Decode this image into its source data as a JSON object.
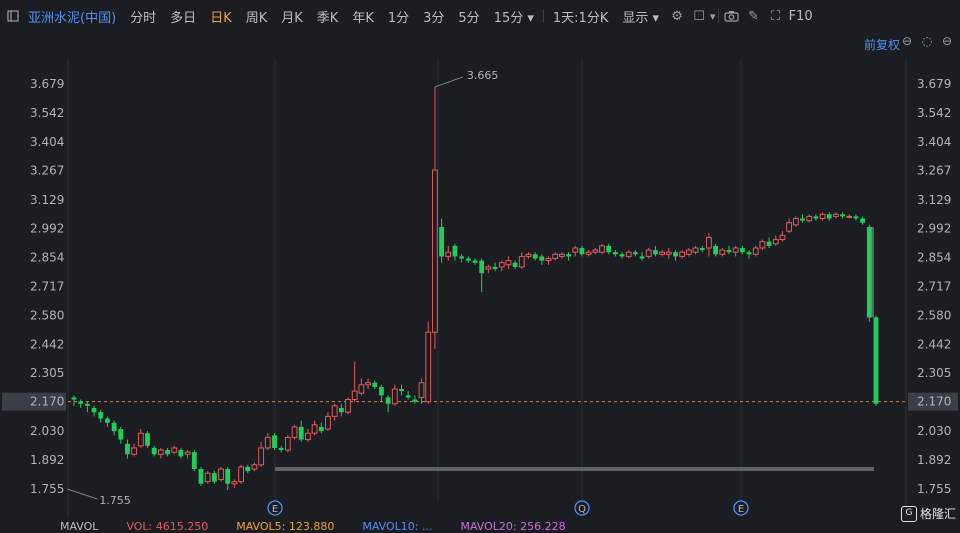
{
  "toolbar": {
    "panel_icon": "panel-toggle-icon",
    "title": "亚洲水泥(中国)",
    "periods": [
      "分时",
      "多日",
      "日K",
      "周K",
      "月K",
      "季K",
      "年K",
      "1分",
      "3分",
      "5分",
      "15分"
    ],
    "active_period": "日K",
    "interval_select": "1天:1分K",
    "display_select": "显示",
    "icons": [
      "gear-icon",
      "square-icon",
      "camera-icon",
      "pencil-icon",
      "fullscreen-icon",
      "f10-icon"
    ],
    "f10_label": "F10"
  },
  "sub": {
    "fuquan": "前复权"
  },
  "price_axis": {
    "ticks": [
      "3.679",
      "3.542",
      "3.404",
      "3.267",
      "3.129",
      "2.992",
      "2.854",
      "2.717",
      "2.580",
      "2.442",
      "2.305",
      "2.170",
      "2.030",
      "1.892",
      "1.755"
    ],
    "current": "2.170"
  },
  "annotations": {
    "high": "3.665",
    "low": "1.755"
  },
  "events": [
    "E",
    "Q",
    "E"
  ],
  "bottom_legend": [
    {
      "text": "MAVOL",
      "color": "#b8bcc4"
    },
    {
      "text": "VOL: 4615.250",
      "color": "#e05b5b"
    },
    {
      "text": "MAVOL5: 123.880",
      "color": "#e7a33e"
    },
    {
      "text": "MAVOL10: ...",
      "color": "#4e8ff2"
    },
    {
      "text": "MAVOL20: 256.228",
      "color": "#c86fd8"
    }
  ],
  "logo": "格隆汇",
  "colors": {
    "up": "#e05b5b",
    "down": "#1fce5a",
    "accent": "#4e8ff2",
    "active": "#e7a33e"
  },
  "chart_data": {
    "type": "candlestick",
    "ylim": [
      1.755,
      3.679
    ],
    "last_price": 2.17,
    "high_label": 3.665,
    "low_label": 1.755,
    "candles": [
      [
        2.19,
        2.18,
        2.2,
        2.15
      ],
      [
        2.17,
        2.16,
        2.18,
        2.14
      ],
      [
        2.16,
        2.15,
        2.17,
        2.12
      ],
      [
        2.14,
        2.12,
        2.15,
        2.1
      ],
      [
        2.12,
        2.09,
        2.13,
        2.07
      ],
      [
        2.09,
        2.07,
        2.1,
        2.05
      ],
      [
        2.07,
        2.03,
        2.08,
        2.01
      ],
      [
        2.04,
        1.99,
        2.05,
        1.97
      ],
      [
        1.97,
        1.92,
        1.99,
        1.9
      ],
      [
        1.92,
        1.95,
        1.97,
        1.91
      ],
      [
        1.96,
        2.02,
        2.04,
        1.95
      ],
      [
        2.02,
        1.96,
        2.03,
        1.95
      ],
      [
        1.95,
        1.92,
        1.96,
        1.91
      ],
      [
        1.92,
        1.94,
        1.95,
        1.9
      ],
      [
        1.94,
        1.92,
        1.95,
        1.91
      ],
      [
        1.93,
        1.95,
        1.96,
        1.92
      ],
      [
        1.94,
        1.91,
        1.95,
        1.9
      ],
      [
        1.92,
        1.93,
        1.94,
        1.9
      ],
      [
        1.93,
        1.85,
        1.94,
        1.84
      ],
      [
        1.85,
        1.78,
        1.86,
        1.77
      ],
      [
        1.79,
        1.83,
        1.84,
        1.78
      ],
      [
        1.83,
        1.79,
        1.84,
        1.78
      ],
      [
        1.8,
        1.85,
        1.86,
        1.79
      ],
      [
        1.85,
        1.78,
        1.86,
        1.75
      ],
      [
        1.78,
        1.79,
        1.8,
        1.76
      ],
      [
        1.79,
        1.86,
        1.87,
        1.78
      ],
      [
        1.86,
        1.84,
        1.87,
        1.83
      ],
      [
        1.85,
        1.87,
        1.88,
        1.84
      ],
      [
        1.87,
        1.95,
        1.98,
        1.86
      ],
      [
        1.95,
        2.0,
        2.02,
        1.94
      ],
      [
        2.01,
        1.95,
        2.02,
        1.94
      ],
      [
        1.95,
        1.94,
        1.96,
        1.93
      ],
      [
        1.94,
        2.0,
        2.01,
        1.93
      ],
      [
        2.0,
        2.05,
        2.06,
        1.99
      ],
      [
        2.05,
        1.99,
        2.08,
        1.98
      ],
      [
        1.99,
        2.02,
        2.04,
        1.98
      ],
      [
        2.02,
        2.06,
        2.08,
        2.01
      ],
      [
        2.05,
        2.03,
        2.07,
        2.02
      ],
      [
        2.04,
        2.1,
        2.12,
        2.03
      ],
      [
        2.1,
        2.15,
        2.16,
        2.08
      ],
      [
        2.14,
        2.12,
        2.16,
        2.1
      ],
      [
        2.12,
        2.18,
        2.19,
        2.11
      ],
      [
        2.18,
        2.22,
        2.36,
        2.17
      ],
      [
        2.21,
        2.25,
        2.28,
        2.2
      ],
      [
        2.25,
        2.26,
        2.28,
        2.23
      ],
      [
        2.26,
        2.24,
        2.27,
        2.23
      ],
      [
        2.24,
        2.2,
        2.25,
        2.17
      ],
      [
        2.19,
        2.16,
        2.2,
        2.12
      ],
      [
        2.16,
        2.23,
        2.25,
        2.15
      ],
      [
        2.23,
        2.22,
        2.25,
        2.2
      ],
      [
        2.2,
        2.19,
        2.22,
        2.18
      ],
      [
        2.18,
        2.17,
        2.2,
        2.16
      ],
      [
        2.19,
        2.26,
        2.28,
        2.16
      ],
      [
        2.17,
        2.5,
        2.55,
        2.16
      ],
      [
        2.5,
        3.27,
        3.665,
        2.42
      ],
      [
        3.0,
        2.86,
        3.04,
        2.83
      ],
      [
        2.86,
        2.88,
        2.91,
        2.84
      ],
      [
        2.91,
        2.86,
        2.92,
        2.84
      ],
      [
        2.86,
        2.85,
        2.87,
        2.83
      ],
      [
        2.85,
        2.84,
        2.86,
        2.83
      ],
      [
        2.84,
        2.83,
        2.85,
        2.82
      ],
      [
        2.84,
        2.78,
        2.85,
        2.69
      ],
      [
        2.8,
        2.81,
        2.82,
        2.78
      ],
      [
        2.81,
        2.8,
        2.83,
        2.79
      ],
      [
        2.81,
        2.83,
        2.84,
        2.79
      ],
      [
        2.82,
        2.84,
        2.86,
        2.8
      ],
      [
        2.83,
        2.81,
        2.84,
        2.8
      ],
      [
        2.81,
        2.86,
        2.88,
        2.8
      ],
      [
        2.86,
        2.87,
        2.88,
        2.85
      ],
      [
        2.87,
        2.85,
        2.88,
        2.84
      ],
      [
        2.86,
        2.84,
        2.87,
        2.82
      ],
      [
        2.84,
        2.85,
        2.86,
        2.82
      ],
      [
        2.85,
        2.87,
        2.88,
        2.84
      ],
      [
        2.86,
        2.87,
        2.88,
        2.85
      ],
      [
        2.87,
        2.86,
        2.88,
        2.84
      ],
      [
        2.88,
        2.9,
        2.91,
        2.86
      ],
      [
        2.9,
        2.87,
        2.91,
        2.86
      ],
      [
        2.87,
        2.88,
        2.89,
        2.86
      ],
      [
        2.88,
        2.89,
        2.9,
        2.87
      ],
      [
        2.88,
        2.91,
        2.92,
        2.87
      ],
      [
        2.91,
        2.88,
        2.92,
        2.87
      ],
      [
        2.88,
        2.87,
        2.89,
        2.86
      ],
      [
        2.87,
        2.86,
        2.88,
        2.85
      ],
      [
        2.86,
        2.88,
        2.89,
        2.85
      ],
      [
        2.88,
        2.87,
        2.89,
        2.86
      ],
      [
        2.86,
        2.85,
        2.88,
        2.84
      ],
      [
        2.86,
        2.89,
        2.9,
        2.85
      ],
      [
        2.89,
        2.87,
        2.91,
        2.86
      ],
      [
        2.87,
        2.88,
        2.89,
        2.86
      ],
      [
        2.87,
        2.88,
        2.9,
        2.85
      ],
      [
        2.88,
        2.86,
        2.89,
        2.84
      ],
      [
        2.86,
        2.88,
        2.89,
        2.85
      ],
      [
        2.87,
        2.89,
        2.9,
        2.86
      ],
      [
        2.88,
        2.9,
        2.91,
        2.87
      ],
      [
        2.9,
        2.89,
        2.91,
        2.88
      ],
      [
        2.9,
        2.95,
        2.97,
        2.86
      ],
      [
        2.91,
        2.87,
        2.92,
        2.86
      ],
      [
        2.87,
        2.89,
        2.9,
        2.86
      ],
      [
        2.89,
        2.88,
        2.91,
        2.87
      ],
      [
        2.88,
        2.9,
        2.91,
        2.86
      ],
      [
        2.9,
        2.88,
        2.91,
        2.87
      ],
      [
        2.88,
        2.87,
        2.89,
        2.85
      ],
      [
        2.87,
        2.9,
        2.91,
        2.86
      ],
      [
        2.9,
        2.93,
        2.94,
        2.89
      ],
      [
        2.93,
        2.91,
        2.95,
        2.9
      ],
      [
        2.92,
        2.94,
        2.96,
        2.91
      ],
      [
        2.94,
        2.96,
        2.98,
        2.93
      ],
      [
        2.98,
        3.02,
        3.04,
        2.97
      ],
      [
        3.01,
        3.04,
        3.05,
        3.0
      ],
      [
        3.04,
        3.03,
        3.06,
        3.02
      ],
      [
        3.03,
        3.05,
        3.06,
        3.02
      ],
      [
        3.05,
        3.04,
        3.06,
        3.03
      ],
      [
        3.04,
        3.06,
        3.07,
        3.03
      ],
      [
        3.06,
        3.04,
        3.07,
        3.03
      ],
      [
        3.05,
        3.06,
        3.07,
        3.04
      ],
      [
        3.06,
        3.05,
        3.07,
        3.04
      ],
      [
        3.05,
        3.05,
        3.06,
        3.04
      ],
      [
        3.05,
        3.04,
        3.06,
        3.03
      ],
      [
        3.04,
        3.02,
        3.05,
        3.01
      ],
      [
        3.0,
        2.57,
        3.01,
        2.55
      ],
      [
        2.57,
        2.16,
        2.58,
        2.15
      ]
    ]
  }
}
